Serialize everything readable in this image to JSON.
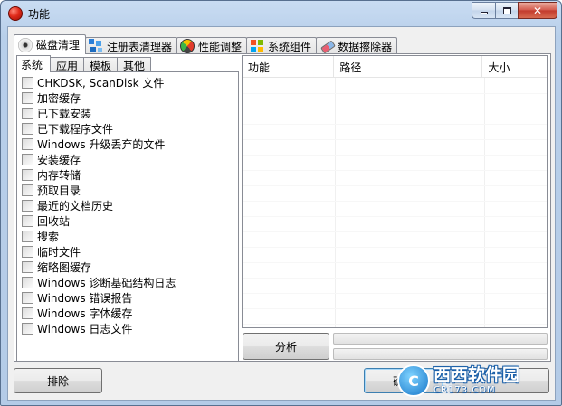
{
  "window": {
    "title": "功能",
    "close_glyph": "✕"
  },
  "main_tabs": [
    {
      "label": "磁盘清理",
      "icon": "disk-icon",
      "active": true
    },
    {
      "label": "注册表清理器",
      "icon": "registry-icon",
      "active": false
    },
    {
      "label": "性能调整",
      "icon": "gauge-icon",
      "active": false
    },
    {
      "label": "系统组件",
      "icon": "windows-icon",
      "active": false
    },
    {
      "label": "数据擦除器",
      "icon": "eraser-icon",
      "active": false
    }
  ],
  "sub_tabs": [
    {
      "label": "系统",
      "active": true
    },
    {
      "label": "应用",
      "active": false
    },
    {
      "label": "模板",
      "active": false
    },
    {
      "label": "其他",
      "active": false
    }
  ],
  "items": [
    {
      "label": "CHKDSK, ScanDisk 文件",
      "checked": false
    },
    {
      "label": "加密缓存",
      "checked": false
    },
    {
      "label": "已下载安装",
      "checked": false
    },
    {
      "label": "已下载程序文件",
      "checked": false
    },
    {
      "label": "Windows 升级丢弃的文件",
      "checked": false
    },
    {
      "label": "安装缓存",
      "checked": false
    },
    {
      "label": "内存转储",
      "checked": false
    },
    {
      "label": "预取目录",
      "checked": false
    },
    {
      "label": "最近的文档历史",
      "checked": false
    },
    {
      "label": "回收站",
      "checked": false
    },
    {
      "label": "搜索",
      "checked": false
    },
    {
      "label": "临时文件",
      "checked": false
    },
    {
      "label": "缩略图缓存",
      "checked": false
    },
    {
      "label": "Windows 诊断基础结构日志",
      "checked": false
    },
    {
      "label": "Windows 错误报告",
      "checked": false
    },
    {
      "label": "Windows 字体缓存",
      "checked": false
    },
    {
      "label": "Windows 日志文件",
      "checked": false
    }
  ],
  "results_table": {
    "columns": [
      "功能",
      "路径",
      "大小"
    ],
    "rows": []
  },
  "buttons": {
    "analyze": "分析",
    "exclude": "排除",
    "ok": "确定",
    "cancel": ""
  },
  "progress": {
    "bar1": 0,
    "bar2": 0
  },
  "watermark": {
    "badge": "C",
    "main": "西西软件园",
    "sub": "CR173.COM"
  }
}
